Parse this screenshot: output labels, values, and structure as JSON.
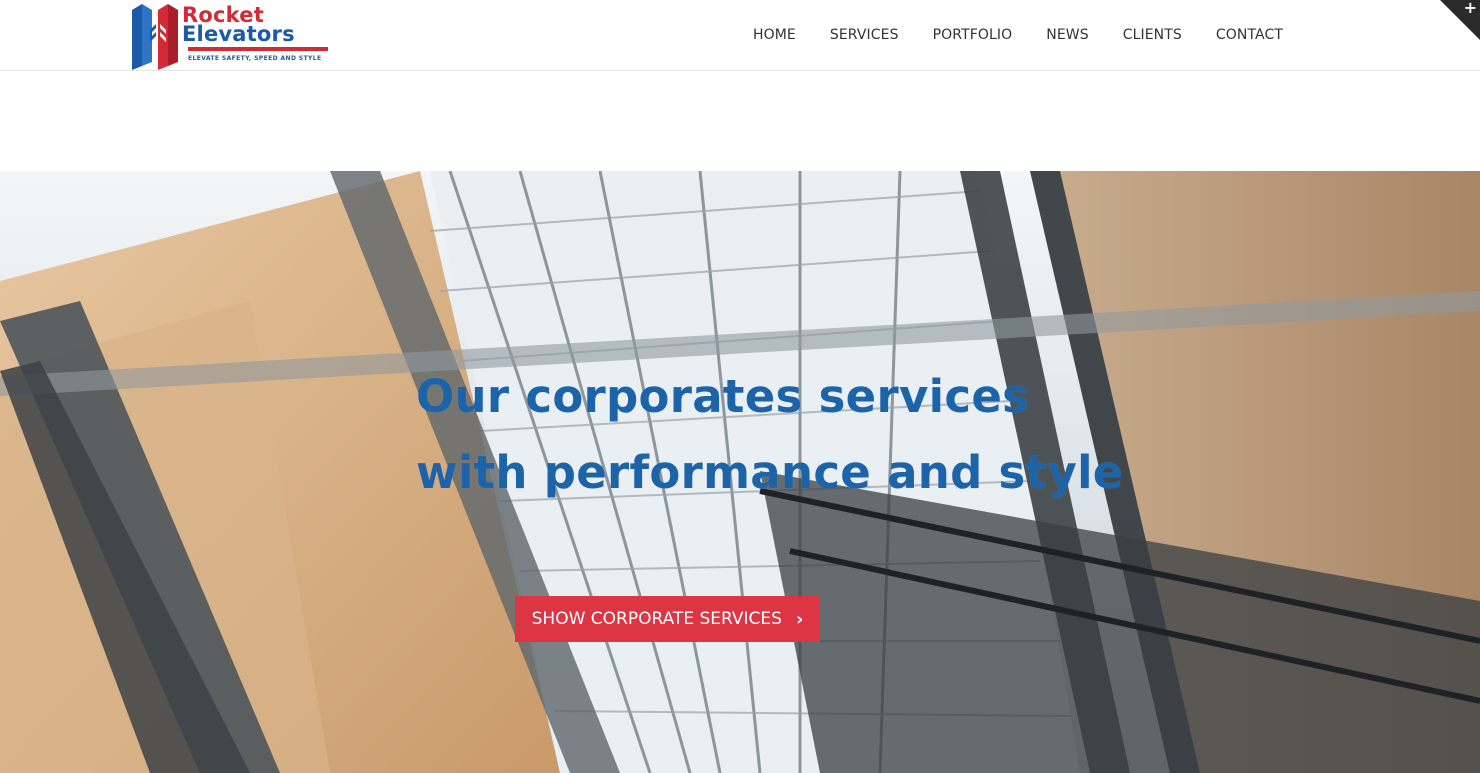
{
  "brand": {
    "name_line1": "Rocket",
    "name_line2": "Elevators",
    "tagline": "ELEVATE SAFETY, SPEED AND STYLE",
    "logo_icon": "building-elevator-logo",
    "colors": {
      "red": "#d32a36",
      "blue": "#1a5aa6"
    }
  },
  "nav": {
    "items": [
      {
        "label": "HOME"
      },
      {
        "label": "SERVICES"
      },
      {
        "label": "PORTFOLIO"
      },
      {
        "label": "NEWS"
      },
      {
        "label": "CLIENTS"
      },
      {
        "label": "CONTACT"
      }
    ]
  },
  "corner_toggle": {
    "icon": "plus-icon",
    "glyph": "+"
  },
  "hero": {
    "title_line1": "Our corporates services",
    "title_line2": "with performance and style",
    "title_color": "#1c63a8",
    "background": "glass-elevator-shaft-photo",
    "cta_label": "SHOW CORPORATE SERVICES",
    "cta_icon": "chevron-right-icon",
    "cta_glyph": "›",
    "cta_color": "#de3545"
  }
}
